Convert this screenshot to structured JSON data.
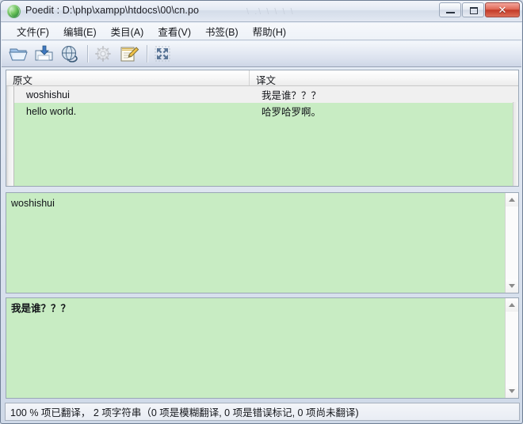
{
  "window": {
    "title": "Poedit : D:\\php\\xampp\\htdocs\\00\\cn.po",
    "ghost_text": "\\ .\\ \\  \\ \\  \\",
    "controls": {
      "minimize": "minimize-button",
      "maximize": "maximize-button",
      "close": "✕"
    }
  },
  "menubar": {
    "items": [
      {
        "label": "文件(F)",
        "name": "menu-file"
      },
      {
        "label": "编辑(E)",
        "name": "menu-edit"
      },
      {
        "label": "类目(A)",
        "name": "menu-catalog"
      },
      {
        "label": "查看(V)",
        "name": "menu-view"
      },
      {
        "label": "书签(B)",
        "name": "menu-bookmarks"
      },
      {
        "label": "帮助(H)",
        "name": "menu-help"
      }
    ]
  },
  "toolbar": {
    "buttons": [
      {
        "icon": "open-folder-icon",
        "name": "toolbar-open"
      },
      {
        "icon": "save-folder-icon",
        "name": "toolbar-save"
      },
      {
        "icon": "globe-update-icon",
        "name": "toolbar-update"
      },
      {
        "icon": "gear-settings-icon",
        "name": "toolbar-settings",
        "disabled": true
      },
      {
        "icon": "notepad-pencil-icon",
        "name": "toolbar-edit-comment"
      },
      {
        "icon": "fullscreen-arrows-icon",
        "name": "toolbar-fullscreen"
      }
    ]
  },
  "list": {
    "columns": [
      {
        "label": "原文",
        "name": "column-source"
      },
      {
        "label": "译文",
        "name": "column-translation"
      }
    ],
    "rows": [
      {
        "source": "woshishui",
        "translation": "我是谁？？？",
        "selected": true
      },
      {
        "source": "hello world.",
        "translation": "哈罗哈罗啊。",
        "selected": false
      }
    ]
  },
  "source_panel": {
    "text": "woshishui"
  },
  "target_panel": {
    "text": "我是谁？？？"
  },
  "statusbar": {
    "text": "100 % 项已翻译， 2 项字符串（0 项是模糊翻译, 0 项是错误标记, 0 项尚未翻译)"
  },
  "colors": {
    "panel_green": "#c8ecc3",
    "selected_row": "#f0f0f0",
    "close_red": "#c33a27"
  }
}
